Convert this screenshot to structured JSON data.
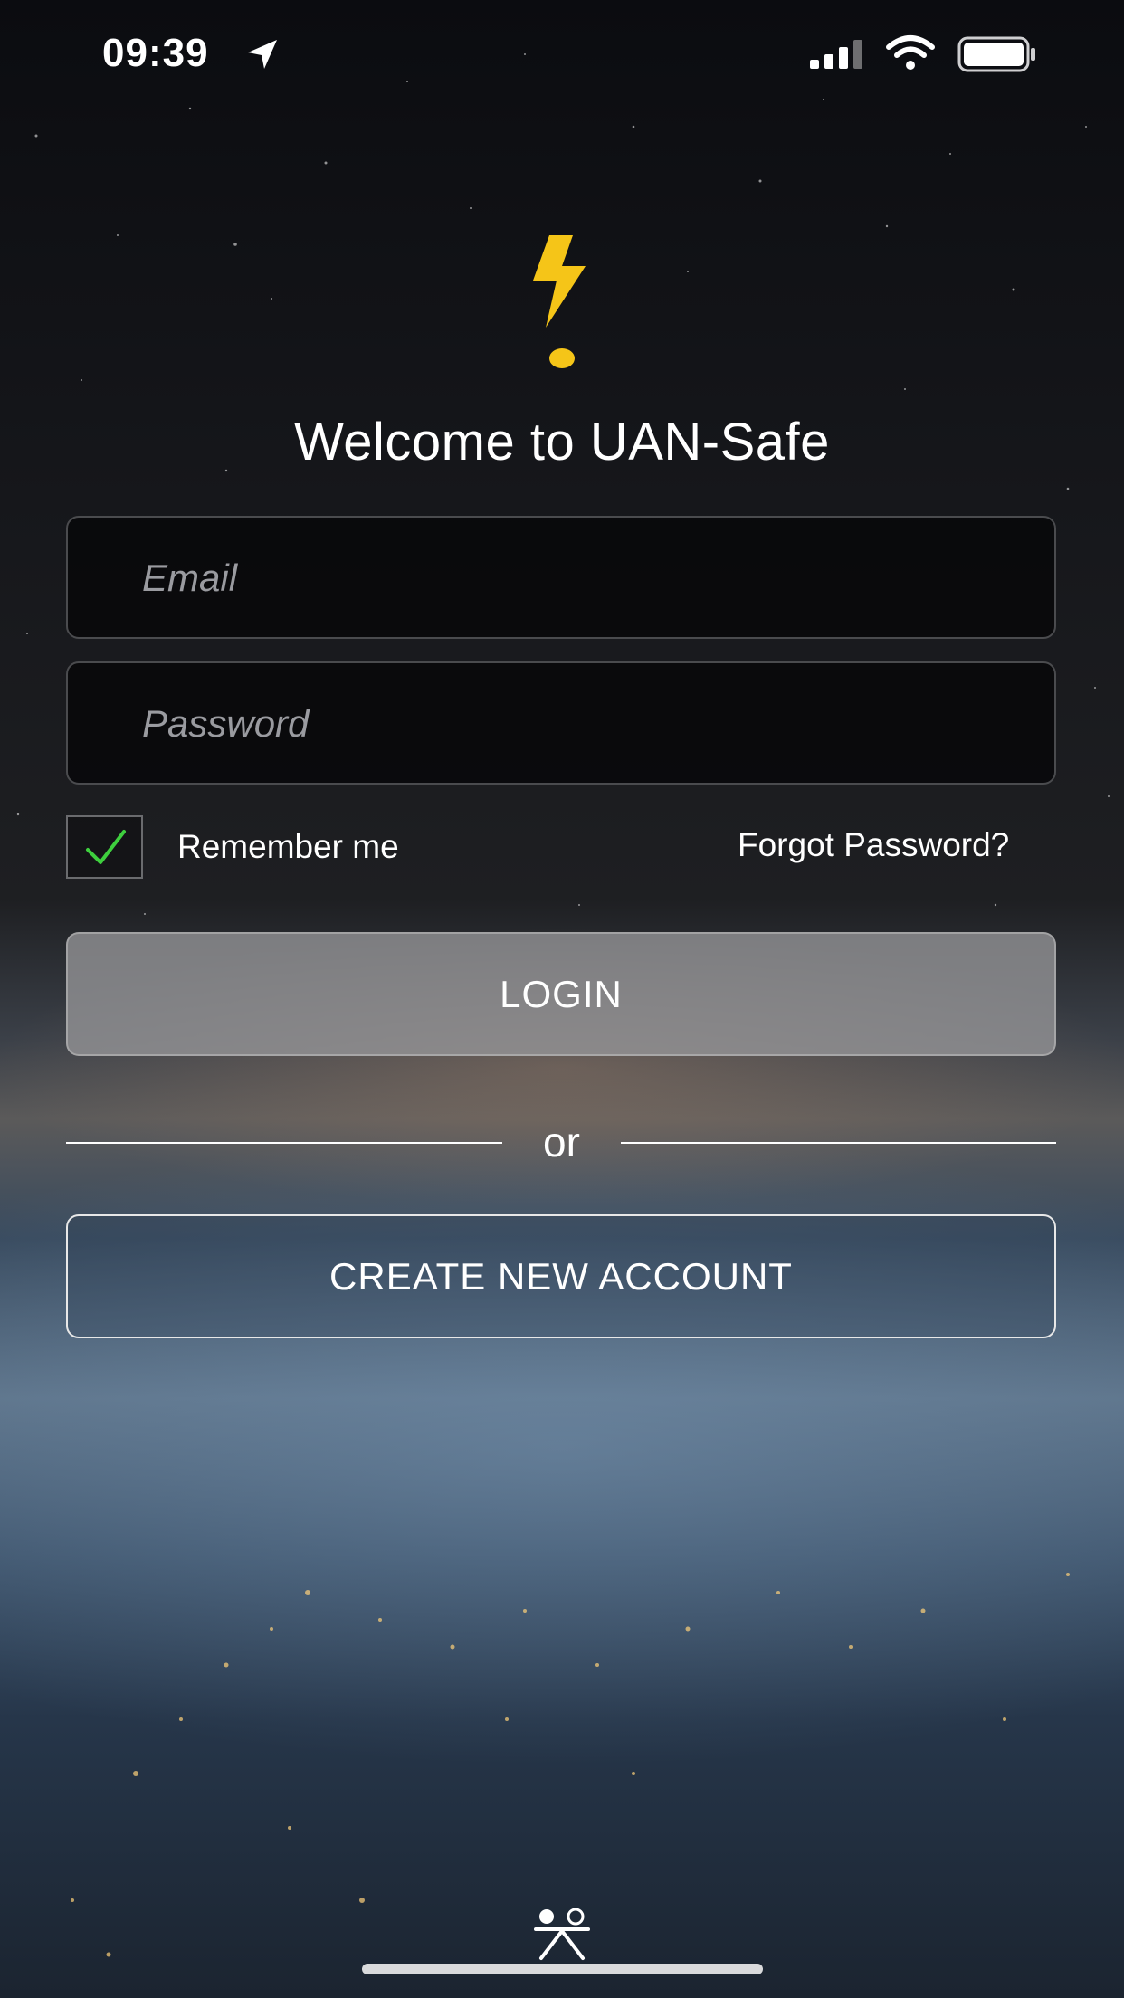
{
  "status_bar": {
    "time": "09:39",
    "icons": [
      "location-arrow-icon",
      "cellular-signal-icon",
      "wifi-icon",
      "battery-icon"
    ]
  },
  "app": {
    "logo_icon": "lightning-exclamation-icon",
    "logo_color": "#f5c518",
    "welcome_text": "Welcome to UAN-Safe"
  },
  "form": {
    "email_placeholder": "Email",
    "email_value": "",
    "password_placeholder": "Password",
    "password_value": "",
    "remember_checked": true,
    "remember_label": "Remember me",
    "forgot_label": "Forgot Password?",
    "checkmark_color": "#3ecf3e",
    "login_label": "LOGIN",
    "divider_text": "or",
    "create_account_label": "CREATE NEW ACCOUNT"
  },
  "footer": {
    "brand_icon": "people-figure-icon"
  }
}
